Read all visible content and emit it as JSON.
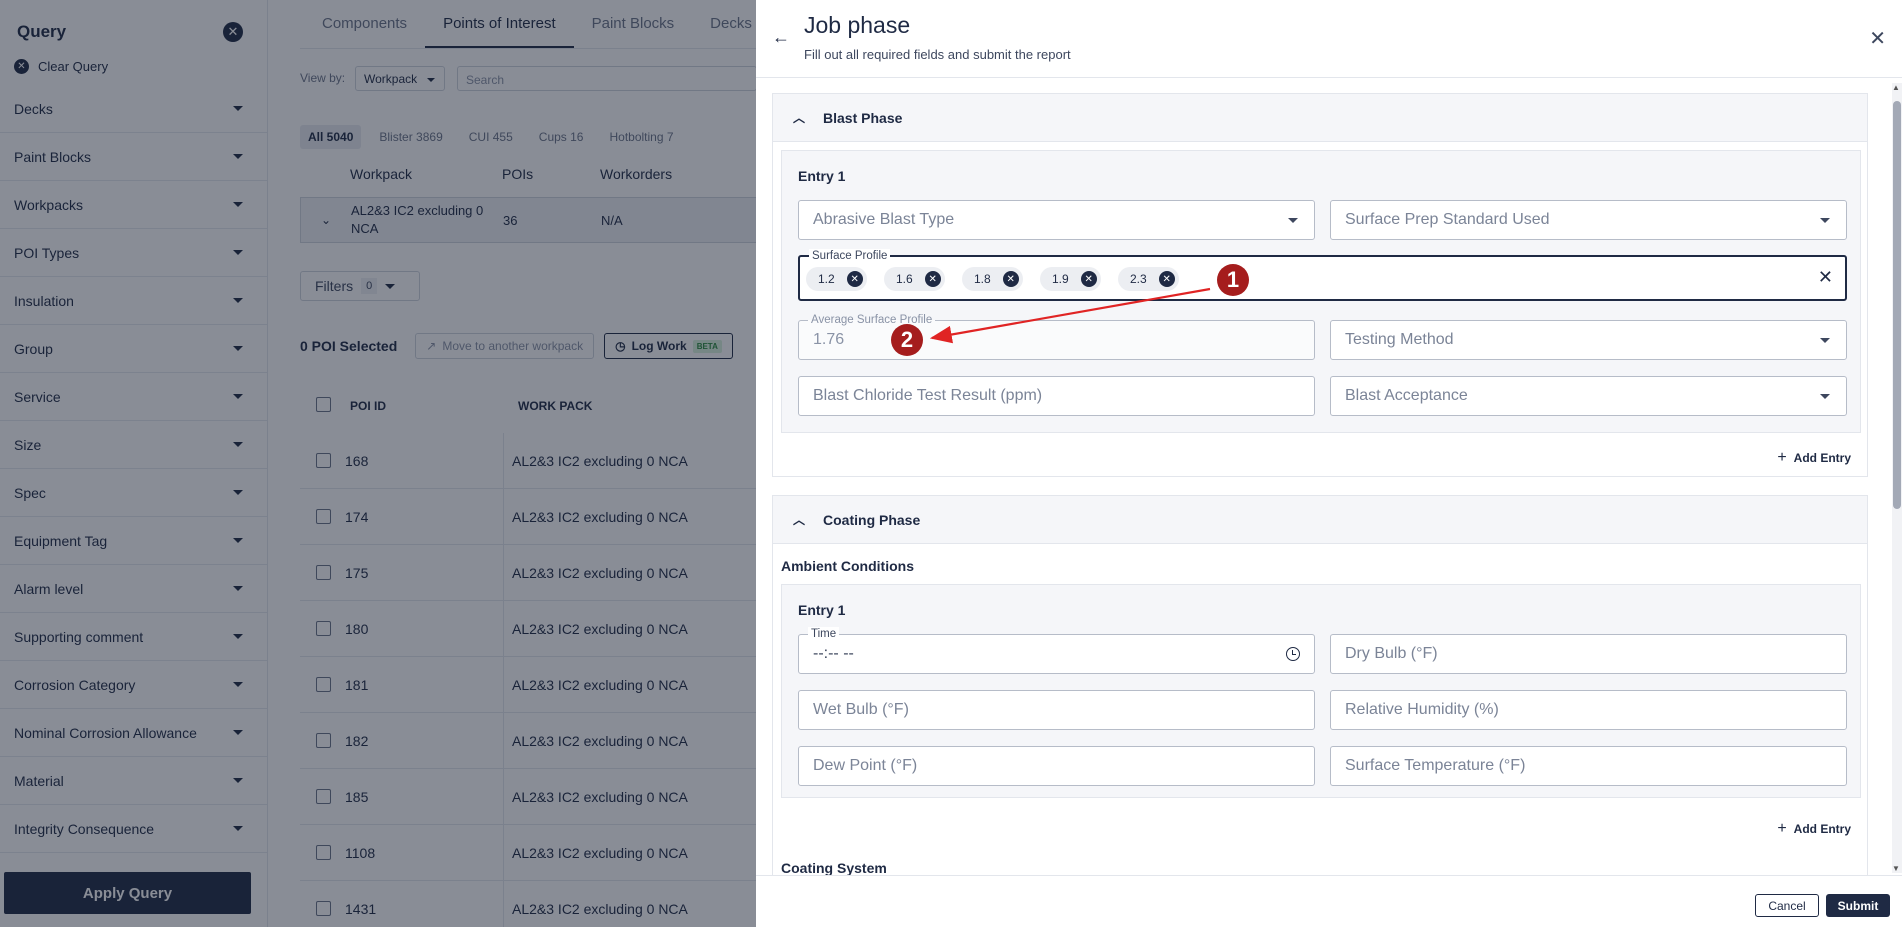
{
  "sidebar": {
    "title": "Query",
    "clear_label": "Clear Query",
    "items": [
      {
        "label": "Decks"
      },
      {
        "label": "Paint Blocks"
      },
      {
        "label": "Workpacks"
      },
      {
        "label": "POI Types"
      },
      {
        "label": "Insulation"
      },
      {
        "label": "Group"
      },
      {
        "label": "Service"
      },
      {
        "label": "Size"
      },
      {
        "label": "Spec"
      },
      {
        "label": "Equipment Tag"
      },
      {
        "label": "Alarm level"
      },
      {
        "label": "Supporting comment"
      },
      {
        "label": "Corrosion Category"
      },
      {
        "label": "Nominal Corrosion Allowance"
      },
      {
        "label": "Material"
      },
      {
        "label": "Integrity Consequence"
      }
    ],
    "apply_label": "Apply Query"
  },
  "main": {
    "tabs": [
      "Components",
      "Points of Interest",
      "Paint Blocks",
      "Decks"
    ],
    "active_tab": "Points of Interest",
    "view_by_label": "View by:",
    "view_by_value": "Workpack",
    "search_placeholder": "Search",
    "chips": [
      "All 5040",
      "Blister 3869",
      "CUI 455",
      "Cups 16",
      "Hotbolting 7"
    ],
    "workpack_headers": [
      "Workpack",
      "POIs",
      "Workorders"
    ],
    "workpack_row": {
      "name": "AL2&3 IC2 excluding 0 NCA",
      "pois": "36",
      "workorders": "N/A"
    },
    "filters_label": "Filters",
    "filters_count": "0",
    "selected_label": "0 POI Selected",
    "move_label": "Move to another workpack",
    "log_work_label": "Log Work",
    "beta_label": "BETA",
    "table_headers": [
      "POI ID",
      "WORK PACK"
    ],
    "rows": [
      {
        "id": "168",
        "pack": "AL2&3 IC2 excluding 0 NCA"
      },
      {
        "id": "174",
        "pack": "AL2&3 IC2 excluding 0 NCA"
      },
      {
        "id": "175",
        "pack": "AL2&3 IC2 excluding 0 NCA"
      },
      {
        "id": "180",
        "pack": "AL2&3 IC2 excluding 0 NCA"
      },
      {
        "id": "181",
        "pack": "AL2&3 IC2 excluding 0 NCA"
      },
      {
        "id": "182",
        "pack": "AL2&3 IC2 excluding 0 NCA"
      },
      {
        "id": "185",
        "pack": "AL2&3 IC2 excluding 0 NCA"
      },
      {
        "id": "1108",
        "pack": "AL2&3 IC2 excluding 0 NCA"
      },
      {
        "id": "1431",
        "pack": "AL2&3 IC2 excluding 0 NCA"
      }
    ]
  },
  "drawer": {
    "title": "Job phase",
    "subtitle": "Fill out all required fields and submit the report",
    "blast": {
      "title": "Blast Phase",
      "entry_label": "Entry 1",
      "abrasive_placeholder": "Abrasive Blast Type",
      "surface_prep_placeholder": "Surface Prep Standard Used",
      "surface_profile_label": "Surface Profile",
      "surface_profile_tags": [
        "1.2",
        "1.6",
        "1.8",
        "1.9",
        "2.3"
      ],
      "avg_label": "Average Surface Profile",
      "avg_value": "1.76",
      "testing_placeholder": "Testing Method",
      "chloride_placeholder": "Blast Chloride Test Result (ppm)",
      "acceptance_placeholder": "Blast Acceptance",
      "add_entry": "Add Entry"
    },
    "coating": {
      "title": "Coating Phase",
      "ambient_title": "Ambient Conditions",
      "entry_label": "Entry 1",
      "time_label": "Time",
      "time_value": "--:-- --",
      "dry_bulb": "Dry Bulb (°F)",
      "wet_bulb": "Wet Bulb (°F)",
      "humidity": "Relative Humidity (%)",
      "dew_point": "Dew Point (°F)",
      "surface_temp": "Surface Temperature (°F)",
      "add_entry": "Add Entry",
      "system_title": "Coating System"
    },
    "cancel_label": "Cancel",
    "submit_label": "Submit"
  },
  "annotations": {
    "badge_1": "1",
    "badge_2": "2",
    "arrow_color": "#e02424",
    "badge_color": "#a51d1d"
  }
}
